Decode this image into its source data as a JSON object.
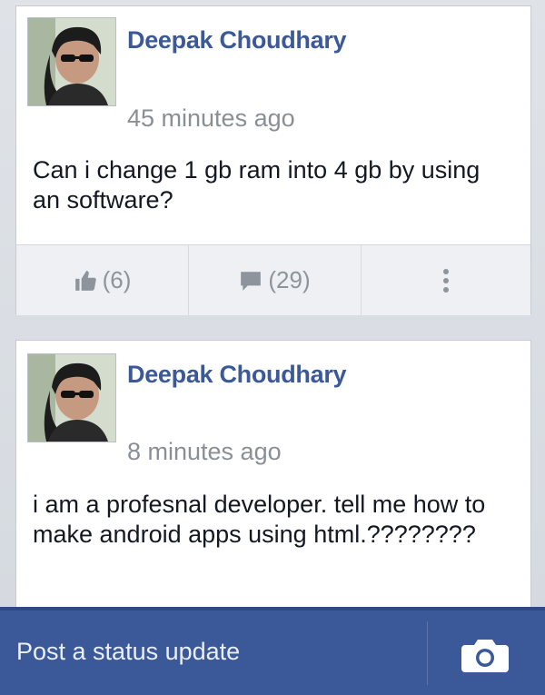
{
  "posts": [
    {
      "author": "Deepak Choudhary",
      "time": "45 minutes ago",
      "text": "Can i change 1 gb ram into 4 gb by using an software?",
      "likes": "(6)",
      "comments": "(29)"
    },
    {
      "author": "Deepak Choudhary",
      "time": "8 minutes ago",
      "text": "i am a profesnal developer. tell me how to make android apps using html.????????"
    }
  ],
  "actions": {
    "like_icon": "thumbs-up-icon",
    "comment_icon": "comment-bubble-icon",
    "more_icon": "more-vertical-icon"
  },
  "status": {
    "placeholder": "Post a status update",
    "camera_icon": "camera-icon"
  },
  "colors": {
    "brand": "#3b5998",
    "time": "#8a8f96",
    "background": "#dfe3e8"
  }
}
